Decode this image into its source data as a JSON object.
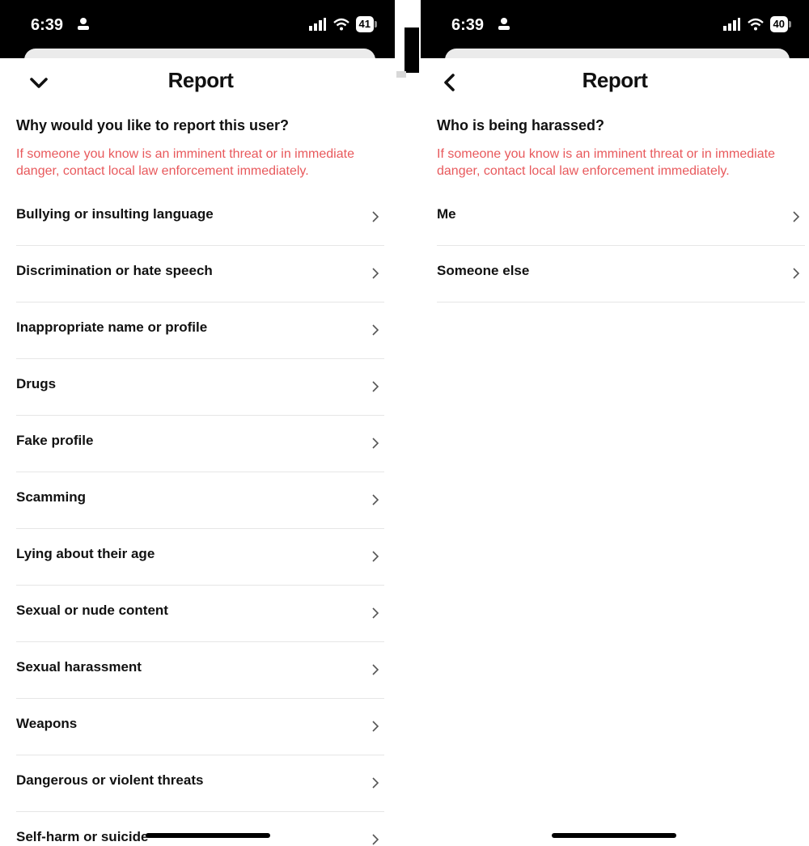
{
  "left_screen": {
    "status": {
      "time": "6:39",
      "battery": "41"
    },
    "header": {
      "title": "Report",
      "nav_icon": "chevron-down-icon"
    },
    "question": "Why would you like to report this user?",
    "warning": "If someone you know is an imminent threat or in immediate danger, contact local law enforcement immediately.",
    "items": [
      {
        "label": "Bullying or insulting language"
      },
      {
        "label": "Discrimination or hate speech"
      },
      {
        "label": "Inappropriate name or profile"
      },
      {
        "label": "Drugs"
      },
      {
        "label": "Fake profile"
      },
      {
        "label": "Scamming"
      },
      {
        "label": "Lying about their age"
      },
      {
        "label": "Sexual or nude content"
      },
      {
        "label": "Sexual harassment"
      },
      {
        "label": "Weapons"
      },
      {
        "label": "Dangerous or violent threats"
      },
      {
        "label": "Self-harm or suicide"
      }
    ]
  },
  "right_screen": {
    "status": {
      "time": "6:39",
      "battery": "40"
    },
    "header": {
      "title": "Report",
      "nav_icon": "chevron-left-icon"
    },
    "question": "Who is being harassed?",
    "warning": "If someone you know is an imminent threat or in immediate danger, contact local law enforcement immediately.",
    "items": [
      {
        "label": "Me"
      },
      {
        "label": "Someone else"
      }
    ]
  },
  "colors": {
    "warning": "#e8595c",
    "status_bar": "#000000",
    "divider": "#e6e6e6"
  }
}
